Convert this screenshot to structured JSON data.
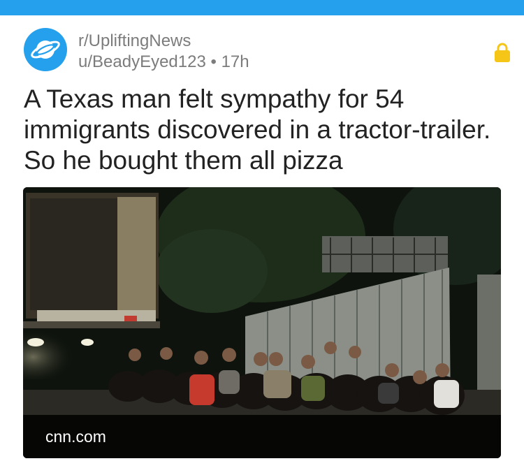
{
  "app": {
    "top_bar_color": "#24a0ed",
    "accent_color": "#24a0ed",
    "lock_color": "#f5c518"
  },
  "post": {
    "subreddit": "r/UpliftingNews",
    "author": "u/BeadyEyed123",
    "separator": "•",
    "age": "17h",
    "title": "A Texas man felt sympathy for 54 immigrants discovered in a tractor-trailer. So he bought them all pizza",
    "subreddit_icon": "reddit-planet-icon",
    "status_icon": "lock-icon",
    "thumbnail": {
      "description_icon": "news-photo",
      "domain": "cnn.com"
    }
  }
}
